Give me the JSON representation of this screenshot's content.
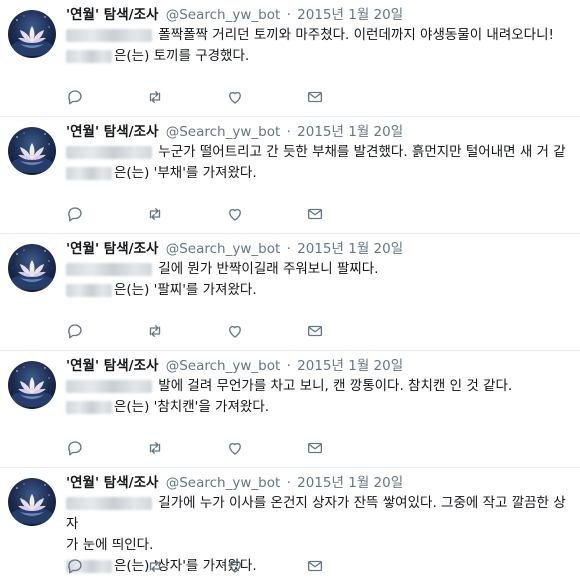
{
  "tweets": [
    {
      "name": "'연월' 탐색/조사",
      "handle": "@Search_yw_bot",
      "separator": "·",
      "date": "2015년 1월 20일",
      "line1": "폴짝폴짝 거리던 토끼와 마주쳤다. 이런데까지 야생동물이 내려오다니!",
      "line2": "",
      "line3": "은(는) 토끼를 구경했다."
    },
    {
      "name": "'연월' 탐색/조사",
      "handle": "@Search_yw_bot",
      "separator": "·",
      "date": "2015년 1월 20일",
      "line1": "누군가 떨어트리고 간 듯한 부채를 발견했다. 흙먼지만 털어내면 새 거 같",
      "line2": "",
      "line3": "은(는) '부채'를 가져왔다."
    },
    {
      "name": "'연월' 탐색/조사",
      "handle": "@Search_yw_bot",
      "separator": "·",
      "date": "2015년 1월 20일",
      "line1": "길에 뭔가 반짝이길래 주워보니 팔찌다.",
      "line2": "",
      "line3": "은(는) '팔찌'를 가져왔다."
    },
    {
      "name": "'연월' 탐색/조사",
      "handle": "@Search_yw_bot",
      "separator": "·",
      "date": "2015년 1월 20일",
      "line1": "발에 걸려 무언가를 차고 보니, 캔 깡통이다. 참치캔 인 것 같다.",
      "line2": "",
      "line3": "은(는) '참치캔'을 가져왔다."
    },
    {
      "name": "'연월' 탐색/조사",
      "handle": "@Search_yw_bot",
      "separator": "·",
      "date": "2015년 1월 20일",
      "line1": "길가에 누가 이사를 온건지 상자가 잔뜩 쌓여있다. 그중에 작고 깔끔한 상자",
      "line2": "가 눈에 띄인다.",
      "line3": "은(는) '상자'를 가져왔다."
    }
  ],
  "colors": {
    "text": "#14171a",
    "secondary": "#657786",
    "icon": "#657786",
    "divider": "#e6ecf0"
  },
  "icons": [
    "reply-icon",
    "retweet-icon",
    "like-icon",
    "message-icon"
  ]
}
